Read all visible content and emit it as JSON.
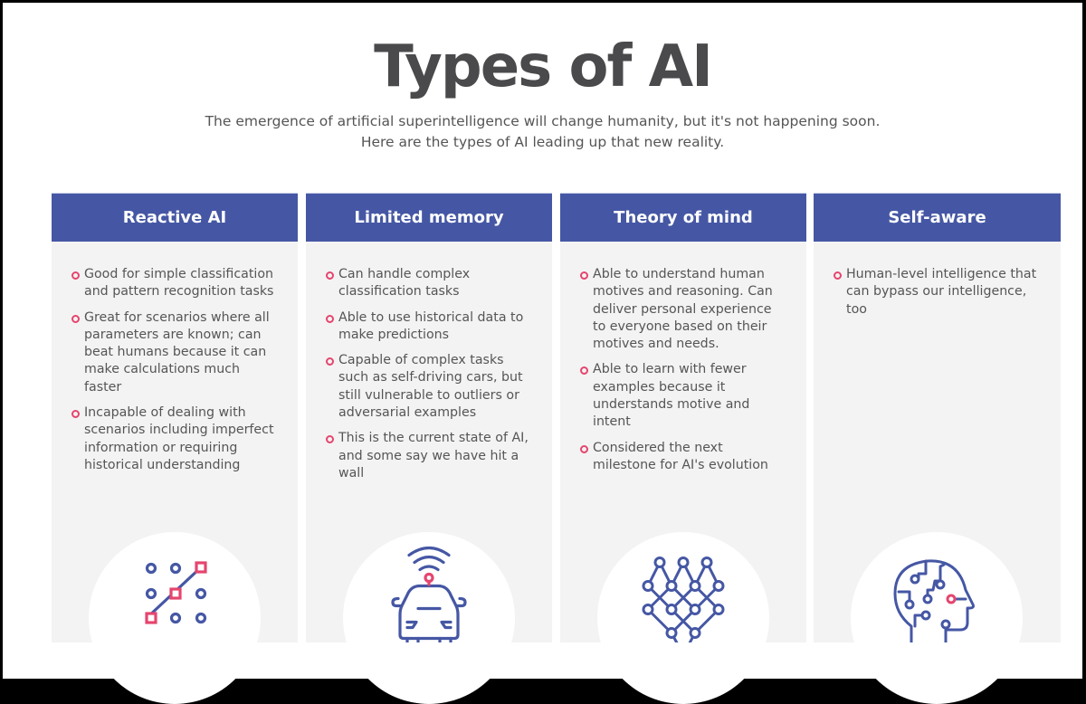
{
  "header": {
    "title": "Types of AI",
    "subtitle_line1": "The emergence of artificial superintelligence will change humanity, but it's not happening soon.",
    "subtitle_line2": "Here are the types of AI leading up that new reality."
  },
  "colors": {
    "header_blue": "#4557a4",
    "accent_pink": "#e5456e",
    "panel_gray": "#f3f3f3",
    "text_gray": "#555555"
  },
  "columns": [
    {
      "title": "Reactive AI",
      "icon": "pattern-grid-icon",
      "bullets": [
        "Good for simple classification and pattern recognition tasks",
        "Great for scenarios where all parameters are known; can beat humans because it can make calculations much faster",
        "Incapable of dealing with scenarios including imperfect information or requiring historical understanding"
      ]
    },
    {
      "title": "Limited memory",
      "icon": "self-driving-car-icon",
      "bullets": [
        "Can handle complex classification tasks",
        "Able to use historical data to make predictions",
        "Capable of complex tasks such as self-driving cars, but still vulnerable to outliers or adversarial examples",
        "This is the current state of AI, and some say we have hit a wall"
      ]
    },
    {
      "title": "Theory of mind",
      "icon": "neural-network-icon",
      "bullets": [
        "Able to understand human motives and reasoning. Can deliver personal experience to everyone based on their motives and needs.",
        "Able to learn with fewer examples because it understands motive and intent",
        "Considered the next milestone for AI's evolution"
      ]
    },
    {
      "title": "Self-aware",
      "icon": "circuit-head-icon",
      "bullets": [
        "Human-level intelligence that can bypass our intelligence, too"
      ]
    }
  ]
}
